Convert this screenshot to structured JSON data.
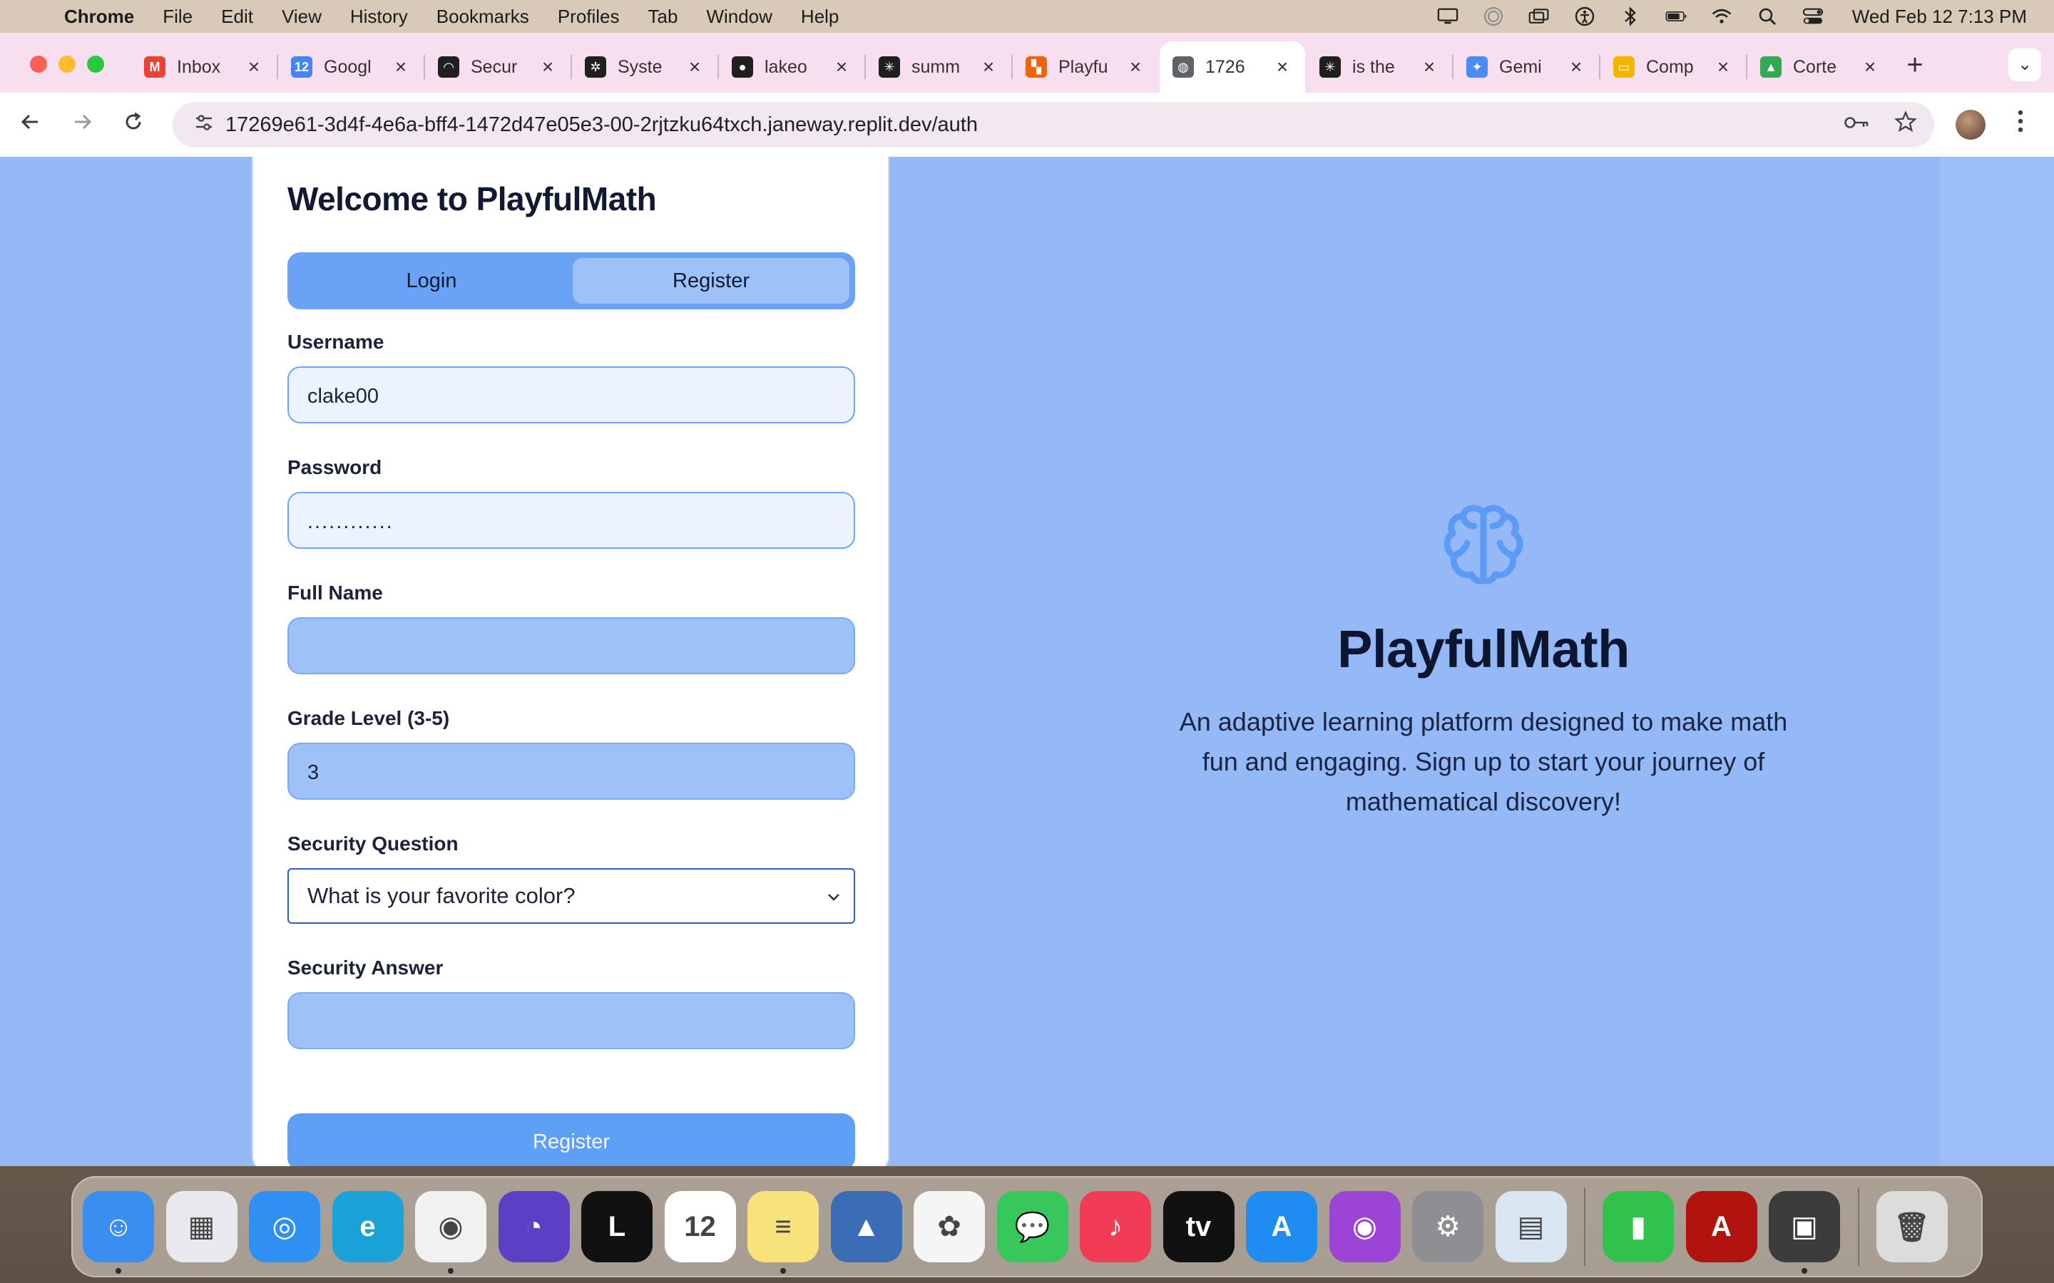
{
  "menubar": {
    "app_name": "Chrome",
    "items": [
      "File",
      "Edit",
      "View",
      "History",
      "Bookmarks",
      "Profiles",
      "Tab",
      "Window",
      "Help"
    ],
    "clock": "Wed Feb 12  7:13 PM",
    "status_icons": [
      "display-icon",
      "airdrop-icon",
      "screen-mirroring-icon",
      "accessibility-icon",
      "bluetooth-icon",
      "battery-icon",
      "wifi-icon",
      "spotlight-search-icon",
      "control-center-icon"
    ]
  },
  "browser": {
    "tabs": [
      {
        "title": "Inbox",
        "favicon": "gmail-icon",
        "color": "#ea4335",
        "glyph": "M"
      },
      {
        "title": "Googl",
        "favicon": "google-calendar-icon",
        "color": "#4285f4",
        "glyph": "12"
      },
      {
        "title": "Secur",
        "favicon": "secure-site-icon",
        "color": "#1f1f1f",
        "glyph": "◠"
      },
      {
        "title": "Syste",
        "favicon": "openai-icon",
        "color": "#1f1f1f",
        "glyph": "✲"
      },
      {
        "title": "lakeo",
        "favicon": "github-icon",
        "color": "#1f1f1f",
        "glyph": "●"
      },
      {
        "title": "summ",
        "favicon": "perplexity-icon",
        "color": "#1f1f1f",
        "glyph": "✳"
      },
      {
        "title": "Playfu",
        "favicon": "replit-icon",
        "color": "#f26207",
        "glyph": "▚"
      },
      {
        "title": "1726",
        "favicon": "globe-icon",
        "color": "#5f6368",
        "glyph": "◍",
        "active": true
      },
      {
        "title": "is the",
        "favicon": "perplexity-icon",
        "color": "#1f1f1f",
        "glyph": "✳"
      },
      {
        "title": "Gemi",
        "favicon": "gemini-icon",
        "color": "#4b8bf5",
        "glyph": "✦"
      },
      {
        "title": "Comp",
        "favicon": "google-slides-icon",
        "color": "#f4b400",
        "glyph": "▭"
      },
      {
        "title": "Corte",
        "favicon": "google-drive-icon",
        "color": "#34a853",
        "glyph": "▲"
      }
    ],
    "new_tab": "+",
    "tab_list": "⌄",
    "url": "17269e61-3d4f-4e6a-bff4-1472d47e05e3-00-2rjtzku64txch.janeway.replit.dev/auth"
  },
  "auth": {
    "title": "Welcome to PlayfulMath",
    "tab_login": "Login",
    "tab_register": "Register",
    "username_label": "Username",
    "username_value": "clake00",
    "password_label": "Password",
    "password_value": "............",
    "fullname_label": "Full Name",
    "fullname_value": "",
    "grade_label": "Grade Level (3-5)",
    "grade_value": "3",
    "security_question_label": "Security Question",
    "security_question_value": "What is your favorite color?",
    "security_answer_label": "Security Answer",
    "security_answer_value": "",
    "submit_label": "Register"
  },
  "hero": {
    "icon": "brain-icon",
    "title": "PlayfulMath",
    "description": "An adaptive learning platform designed to make math fun and engaging. Sign up to start your journey of mathematical discovery!"
  },
  "dock": {
    "apps": [
      {
        "name": "finder-icon",
        "color": "#3a8ef0",
        "glyph": "☺",
        "running": true
      },
      {
        "name": "launchpad-icon",
        "color": "#e8e8ee",
        "glyph": "▦"
      },
      {
        "name": "safari-icon",
        "color": "#2f8ff2",
        "glyph": "◎"
      },
      {
        "name": "edge-icon",
        "color": "#1aa2d8",
        "glyph": "e"
      },
      {
        "name": "chrome-icon",
        "color": "#f1f1f1",
        "glyph": "◉",
        "running": true
      },
      {
        "name": "firefox-icon",
        "color": "#5b3fc4",
        "glyph": "◔"
      },
      {
        "name": "lasso-icon",
        "color": "#111111",
        "glyph": "L"
      },
      {
        "name": "calendar-icon",
        "color": "#ffffff",
        "glyph": "12"
      },
      {
        "name": "notes-icon",
        "color": "#f7e27c",
        "glyph": "≡",
        "running": true
      },
      {
        "name": "linear-icon",
        "color": "#3a6db5",
        "glyph": "▲"
      },
      {
        "name": "photos-icon",
        "color": "#f5f5f5",
        "glyph": "✿"
      },
      {
        "name": "messages-icon",
        "color": "#37c75a",
        "glyph": "💬"
      },
      {
        "name": "music-icon",
        "color": "#f23c55",
        "glyph": "♪"
      },
      {
        "name": "apple-tv-icon",
        "color": "#111111",
        "glyph": "tv"
      },
      {
        "name": "app-store-icon",
        "color": "#1e8cf0",
        "glyph": "A"
      },
      {
        "name": "podcasts-icon",
        "color": "#9b44d6",
        "glyph": "◉"
      },
      {
        "name": "system-settings-icon",
        "color": "#8e8e93",
        "glyph": "⚙"
      },
      {
        "name": "preview-icon",
        "color": "#d9e6f2",
        "glyph": "▤"
      },
      {
        "name": "numbers-icon",
        "color": "#30c24c",
        "glyph": "▮",
        "divider_before": true
      },
      {
        "name": "acrobat-icon",
        "color": "#b3130f",
        "glyph": "A"
      },
      {
        "name": "photo-booth-icon",
        "color": "#3c3c3c",
        "glyph": "▣",
        "running": true
      },
      {
        "name": "trash-icon",
        "color": "#dcdcdc",
        "glyph": "🗑",
        "divider_before": true
      }
    ]
  }
}
